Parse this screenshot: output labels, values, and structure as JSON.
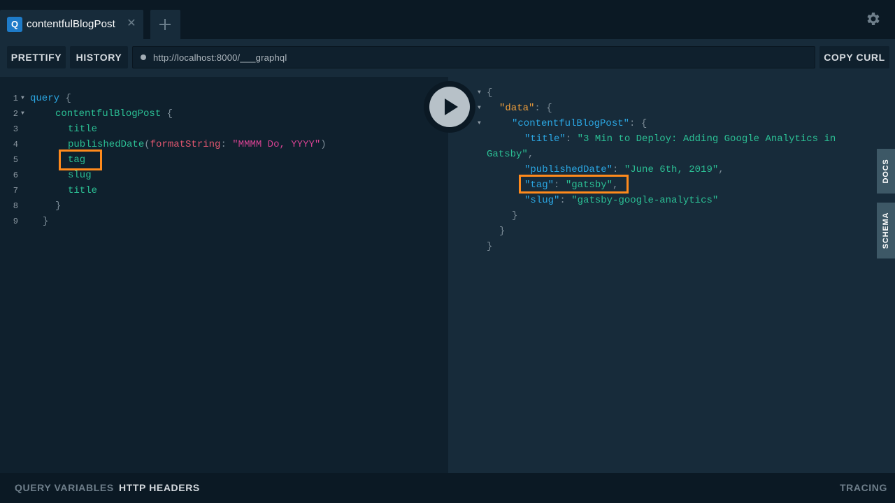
{
  "tabbar": {
    "tab_badge": "Q",
    "tab_title": "contentfulBlogPost",
    "tab_close": "✕",
    "icons": {
      "add": "plus-icon",
      "settings": "gear-icon"
    }
  },
  "toolbar": {
    "prettify_label": "PRETTIFY",
    "history_label": "HISTORY",
    "url": "http://localhost:8000/___graphql",
    "copy_curl_label": "COPY CURL"
  },
  "editor": {
    "line_numbers": [
      "1",
      "2",
      "3",
      "4",
      "5",
      "6",
      "7",
      "8",
      "9"
    ],
    "query_keyword": "query",
    "open_brace": "{",
    "close_brace": "}",
    "root_field": "contentfulBlogPost",
    "fields": {
      "title": "title",
      "published_date": "publishedDate",
      "tag": "tag",
      "slug": "slug",
      "title2": "title"
    },
    "arg_name": "formatString",
    "arg_value": "\"MMMM Do, YYYY\"",
    "paren_open": "(",
    "paren_close": ")",
    "colon": ":"
  },
  "results": {
    "open_brace": "{",
    "close_brace": "}",
    "data_key": "\"data\"",
    "blog_key": "\"contentfulBlogPost\"",
    "title_key": "\"title\"",
    "title_value_part1": "\"3 Min to Deploy: Adding Google Analytics in",
    "title_value_part2": "Gatsby\"",
    "comma": ",",
    "colon": ":",
    "published_key": "\"publishedDate\"",
    "published_value": "\"June 6th, 2019\"",
    "tag_key": "\"tag\"",
    "tag_value": "\"gatsby\"",
    "slug_key": "\"slug\"",
    "slug_value": "\"gatsby-google-analytics\""
  },
  "sidebar": {
    "docs_label": "DOCS",
    "schema_label": "SCHEMA"
  },
  "bottombar": {
    "query_variables_label": "QUERY VARIABLES",
    "http_headers_label": "HTTP HEADERS",
    "tracing_label": "TRACING"
  },
  "colors": {
    "background": "#0f202d",
    "results_background": "#172b3a",
    "highlight": "#ff8a1c",
    "keyword": "#2ba7e3",
    "field": "#2bbf94",
    "argument": "#e0566f",
    "string": "#d64292",
    "result_key": "#f5a13a"
  }
}
